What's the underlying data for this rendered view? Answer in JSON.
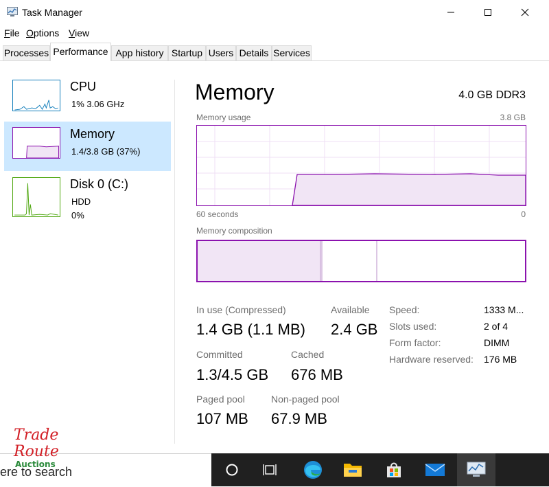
{
  "window": {
    "title": "Task Manager"
  },
  "menu": [
    {
      "key": "F",
      "rest": "ile"
    },
    {
      "key": "O",
      "rest": "ptions"
    },
    {
      "key": "V",
      "rest": "iew"
    }
  ],
  "tabs": [
    "Processes",
    "Performance",
    "App history",
    "Startup",
    "Users",
    "Details",
    "Services"
  ],
  "active_tab": "Performance",
  "resources": [
    {
      "name": "CPU",
      "sub1": "1%  3.06 GHz",
      "sub2": "",
      "color": "#117dbb"
    },
    {
      "name": "Memory",
      "sub1": "1.4/3.8 GB (37%)",
      "sub2": "",
      "color": "#8b12ae"
    },
    {
      "name": "Disk 0 (C:)",
      "sub1": "HDD",
      "sub2": "0%",
      "color": "#4da60c"
    }
  ],
  "main": {
    "title": "Memory",
    "hardware": "4.0 GB DDR3",
    "usage_label": "Memory usage",
    "usage_max": "3.8 GB",
    "time_left": "60 seconds",
    "time_right": "0",
    "composition_label": "Memory composition",
    "accent": "#8b12ae",
    "usage_fraction": 0.37
  },
  "stats": {
    "in_use_label": "In use (Compressed)",
    "in_use_value": "1.4 GB (1.1 MB)",
    "available_label": "Available",
    "available_value": "2.4 GB",
    "committed_label": "Committed",
    "committed_value": "1.3/4.5 GB",
    "cached_label": "Cached",
    "cached_value": "676 MB",
    "paged_label": "Paged pool",
    "paged_value": "107 MB",
    "nonpaged_label": "Non-paged pool",
    "nonpaged_value": "67.9 MB"
  },
  "specs": [
    {
      "label": "Speed:",
      "value": "1333 M..."
    },
    {
      "label": "Slots used:",
      "value": "2 of 4"
    },
    {
      "label": "Form factor:",
      "value": "DIMM"
    },
    {
      "label": "Hardware reserved:",
      "value": "176 MB"
    }
  ],
  "taskbar": {
    "search_text": "ere to search",
    "icons": [
      "cortana-icon",
      "task-view-icon",
      "edge-icon",
      "file-explorer-icon",
      "store-icon",
      "mail-icon",
      "task-manager-icon"
    ]
  },
  "watermark": {
    "line1": "Trade",
    "line2": "Route",
    "line3": "Auctions"
  }
}
